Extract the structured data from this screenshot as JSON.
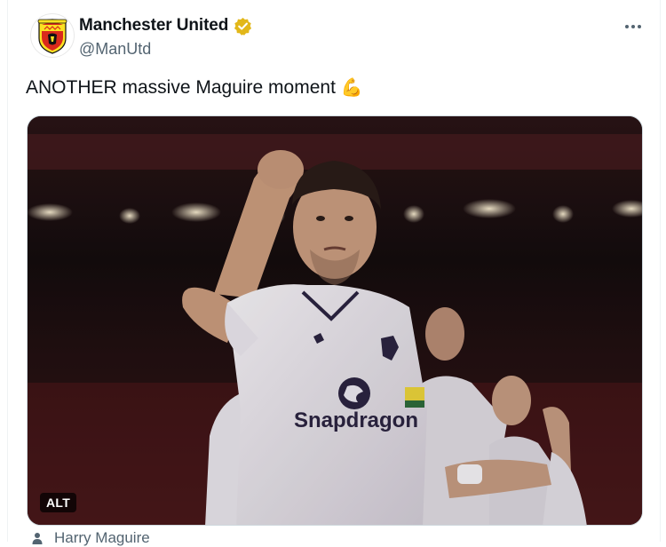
{
  "account": {
    "display_name": "Manchester United",
    "handle": "@ManUtd",
    "verified": true,
    "verified_color": "#e2b719",
    "crest_colors": {
      "red": "#da291c",
      "gold": "#fbe122",
      "black": "#111111"
    }
  },
  "tweet": {
    "text": "ANOTHER massive Maguire moment",
    "emoji": "💪"
  },
  "media": {
    "alt_badge": "ALT",
    "sponsor_text": "Snapdragon",
    "icon": "photo"
  },
  "tagged": {
    "label": "Harry Maguire",
    "icon": "person-icon"
  },
  "colors": {
    "text_primary": "#0f1419",
    "text_secondary": "#536471",
    "border": "#cfd9de"
  }
}
